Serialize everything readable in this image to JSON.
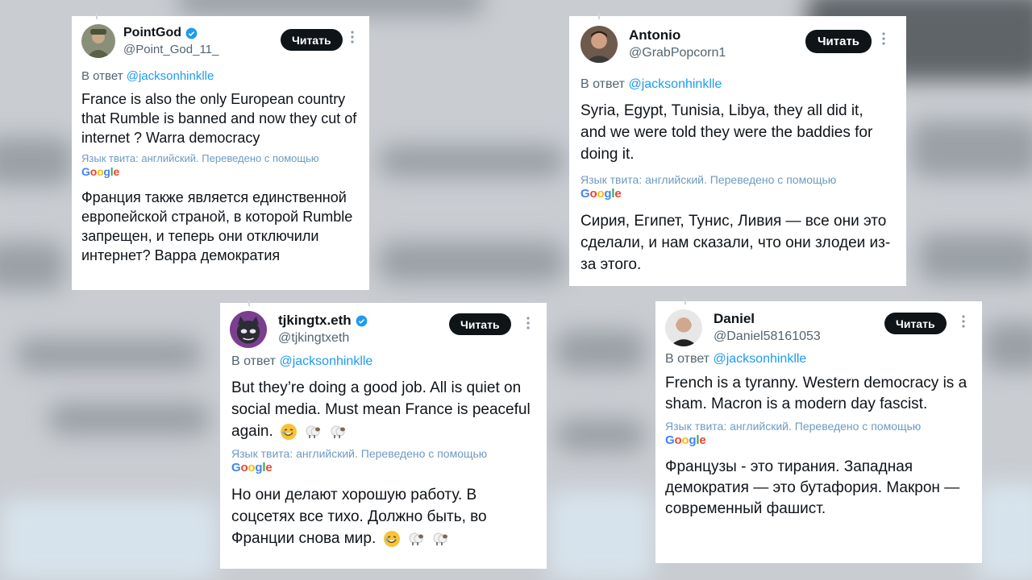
{
  "colors": {
    "accent": "#1d9bf0",
    "button_bg": "#0f1419",
    "secondary_text": "#536471",
    "translation_note": "#6e9ac2"
  },
  "tweets": [
    {
      "name": "PointGod",
      "handle": "@Point_God_11_",
      "verified": true,
      "avatar_icon": "soldier-avatar-icon",
      "read_button": "Читать",
      "reply_prefix": "В ответ",
      "reply_mention": "@jacksonhinklle",
      "text": "France is also the only European country that Rumble is banned and now they cut of internet ? Warra democracy",
      "translation_note": "Язык твита: английский. Переведено с помощью",
      "translation_provider": "Google",
      "translation": "Франция также является единственной европейской страной, в которой Rumble запрещен, и теперь они отключили интернет? Варра демократия"
    },
    {
      "name": "Antonio",
      "handle": "@GrabPopcorn1",
      "verified": false,
      "avatar_icon": "man-avatar-icon",
      "read_button": "Читать",
      "reply_prefix": "В ответ",
      "reply_mention": "@jacksonhinklle",
      "text": "Syria, Egypt, Tunisia, Libya, they all did it, and we were told they were the baddies for doing it.",
      "translation_note": "Язык твита: английский. Переведено с помощью",
      "translation_provider": "Google",
      "translation": "Сирия, Египет, Тунис, Ливия — все они это сделали, и нам сказали, что они злодеи из-за этого."
    },
    {
      "name": "tjkingtx.eth",
      "handle": "@tjkingtxeth",
      "verified": true,
      "avatar_icon": "cat-avatar-icon",
      "read_button": "Читать",
      "reply_prefix": "В ответ",
      "reply_mention": "@jacksonhinklle",
      "text": "But they’re doing a good job. All is quiet on social media. Must mean France is peaceful again.",
      "emojis": [
        "rofl-emoji-icon",
        "sheep-emoji-icon",
        "sheep-emoji-icon"
      ],
      "translation_note": "Язык твита: английский. Переведено с помощью",
      "translation_provider": "Google",
      "translation": "Но они делают хорошую работу. В соцсетях все тихо. Должно быть, во Франции снова мир."
    },
    {
      "name": "Daniel",
      "handle": "@Daniel58161053",
      "verified": false,
      "avatar_icon": "man-avatar-icon",
      "read_button": "Читать",
      "reply_prefix": "В ответ",
      "reply_mention": "@jacksonhinklle",
      "text": "French is a tyranny. Western democracy is a sham. Macron is a modern day fascist.",
      "translation_note": "Язык твита: английский. Переведено с помощью",
      "translation_provider": "Google",
      "translation": "Французы - это тирания. Западная демократия — это бутафория. Макрон — современный фашист."
    }
  ]
}
